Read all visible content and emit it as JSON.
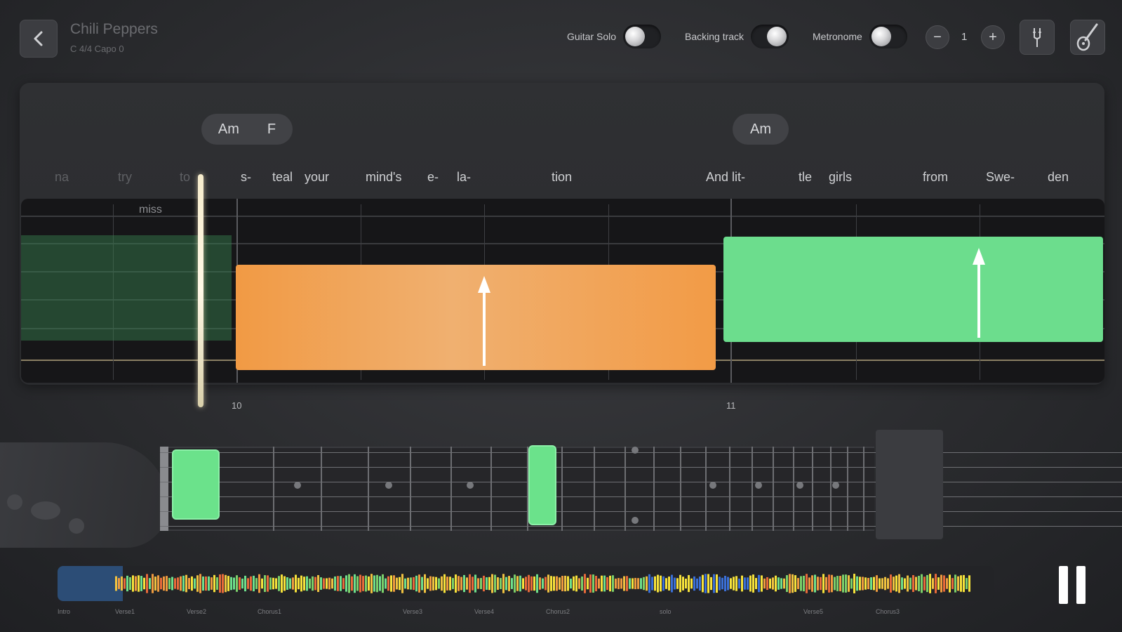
{
  "header": {
    "song_title": "Chili Peppers",
    "song_meta": "C 4/4   Capo 0",
    "toggles": [
      {
        "label": "Guitar Solo",
        "on": false
      },
      {
        "label": "Backing track",
        "on": true
      },
      {
        "label": "Metronome",
        "on": false
      }
    ],
    "speed_value": "1",
    "minus_label": "−",
    "plus_label": "+"
  },
  "chords": [
    {
      "labels": [
        "Am",
        "F"
      ]
    },
    {
      "labels": [
        "Am"
      ]
    }
  ],
  "lyrics": {
    "past": [
      "na",
      "try",
      "to"
    ],
    "upcoming": [
      "s-",
      "teal",
      "your",
      "mind's",
      "e-",
      "la-",
      "tion",
      "And",
      "lit-",
      "tle",
      "girls",
      "from",
      "Swe-",
      "den"
    ]
  },
  "miss_label": "miss",
  "measures": [
    "10",
    "11"
  ],
  "timeline": {
    "sections": [
      "Intro",
      "Verse1",
      "Verse2",
      "Chorus1",
      "Verse3",
      "Verse4",
      "Chorus2",
      "solo",
      "Verse5",
      "Chorus3"
    ],
    "progress": 0.07
  },
  "colors": {
    "current_block": "#f19a44",
    "next_block": "#6cdd8d",
    "accent_green": "#6be28b"
  }
}
